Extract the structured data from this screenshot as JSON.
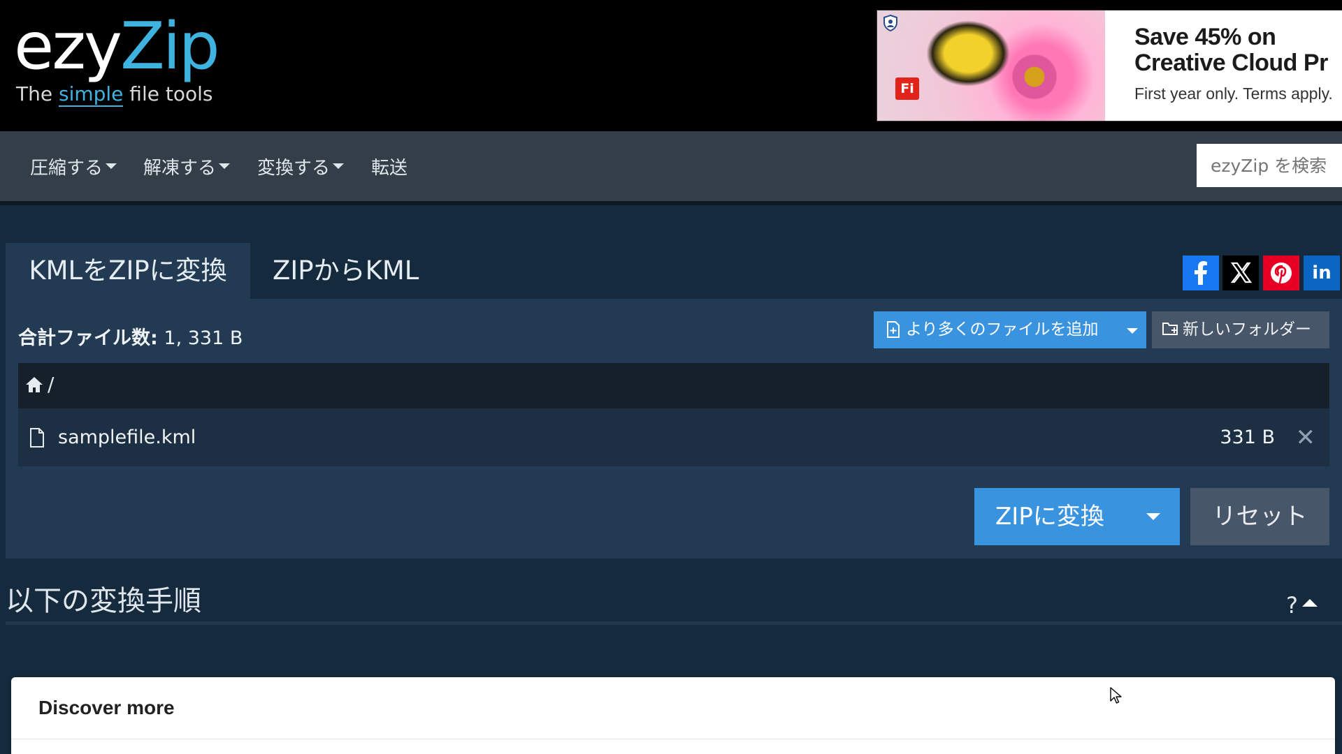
{
  "logo": {
    "part1": "ezy",
    "part2": "Zip",
    "tagline_pre": "The ",
    "tagline_simple": "simple",
    "tagline_post": " file tools"
  },
  "ad": {
    "headline_line1": "Save 45% on",
    "headline_line2": "Creative Cloud Pr",
    "subtext": "First year only. Terms apply.",
    "badge": "Fi"
  },
  "nav": {
    "items": [
      {
        "label": "圧縮する",
        "dropdown": true
      },
      {
        "label": "解凍する",
        "dropdown": true
      },
      {
        "label": "変換する",
        "dropdown": true
      },
      {
        "label": "転送",
        "dropdown": false
      }
    ],
    "search_placeholder": "ezyZip を検索"
  },
  "tabs": {
    "active": "KMLをZIPに変換",
    "inactive": "ZIPからKML"
  },
  "share": [
    {
      "icon": "facebook-icon",
      "glyph": "f",
      "color": "#1877f2"
    },
    {
      "icon": "x-icon",
      "glyph": "X",
      "color": "#000000"
    },
    {
      "icon": "pinterest-icon",
      "glyph": "P",
      "color": "#e60023"
    },
    {
      "icon": "linkedin-icon",
      "glyph": "in",
      "color": "#0a66c2"
    }
  ],
  "summary": {
    "label": "合計ファイル数:",
    "value": " 1, 331 B"
  },
  "buttons": {
    "add_files": "より多くのファイルを追加",
    "new_folder": "新しいフォルダー",
    "convert": "ZIPに変換",
    "reset": "リセット"
  },
  "breadcrumb": {
    "path": "/"
  },
  "files": [
    {
      "name": "samplefile.kml",
      "size": "331 B"
    }
  ],
  "section": {
    "title": "以下の変換手順",
    "help": "?"
  },
  "discover": {
    "title": "Discover more"
  },
  "colors": {
    "accent": "#3a93df",
    "nav_bg": "#343e48",
    "panel_bg": "#223a52",
    "page_bg": "#152a3d"
  }
}
